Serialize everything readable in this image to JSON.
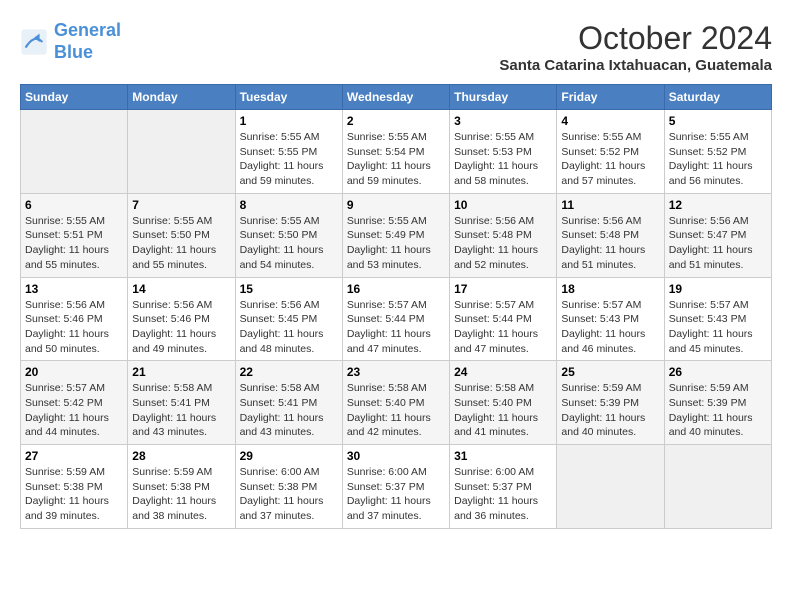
{
  "header": {
    "logo_line1": "General",
    "logo_line2": "Blue",
    "month": "October 2024",
    "location": "Santa Catarina Ixtahuacan, Guatemala"
  },
  "days_of_week": [
    "Sunday",
    "Monday",
    "Tuesday",
    "Wednesday",
    "Thursday",
    "Friday",
    "Saturday"
  ],
  "weeks": [
    [
      {
        "day": "",
        "sunrise": "",
        "sunset": "",
        "daylight": ""
      },
      {
        "day": "",
        "sunrise": "",
        "sunset": "",
        "daylight": ""
      },
      {
        "day": "1",
        "sunrise": "Sunrise: 5:55 AM",
        "sunset": "Sunset: 5:55 PM",
        "daylight": "Daylight: 11 hours and 59 minutes."
      },
      {
        "day": "2",
        "sunrise": "Sunrise: 5:55 AM",
        "sunset": "Sunset: 5:54 PM",
        "daylight": "Daylight: 11 hours and 59 minutes."
      },
      {
        "day": "3",
        "sunrise": "Sunrise: 5:55 AM",
        "sunset": "Sunset: 5:53 PM",
        "daylight": "Daylight: 11 hours and 58 minutes."
      },
      {
        "day": "4",
        "sunrise": "Sunrise: 5:55 AM",
        "sunset": "Sunset: 5:52 PM",
        "daylight": "Daylight: 11 hours and 57 minutes."
      },
      {
        "day": "5",
        "sunrise": "Sunrise: 5:55 AM",
        "sunset": "Sunset: 5:52 PM",
        "daylight": "Daylight: 11 hours and 56 minutes."
      }
    ],
    [
      {
        "day": "6",
        "sunrise": "Sunrise: 5:55 AM",
        "sunset": "Sunset: 5:51 PM",
        "daylight": "Daylight: 11 hours and 55 minutes."
      },
      {
        "day": "7",
        "sunrise": "Sunrise: 5:55 AM",
        "sunset": "Sunset: 5:50 PM",
        "daylight": "Daylight: 11 hours and 55 minutes."
      },
      {
        "day": "8",
        "sunrise": "Sunrise: 5:55 AM",
        "sunset": "Sunset: 5:50 PM",
        "daylight": "Daylight: 11 hours and 54 minutes."
      },
      {
        "day": "9",
        "sunrise": "Sunrise: 5:55 AM",
        "sunset": "Sunset: 5:49 PM",
        "daylight": "Daylight: 11 hours and 53 minutes."
      },
      {
        "day": "10",
        "sunrise": "Sunrise: 5:56 AM",
        "sunset": "Sunset: 5:48 PM",
        "daylight": "Daylight: 11 hours and 52 minutes."
      },
      {
        "day": "11",
        "sunrise": "Sunrise: 5:56 AM",
        "sunset": "Sunset: 5:48 PM",
        "daylight": "Daylight: 11 hours and 51 minutes."
      },
      {
        "day": "12",
        "sunrise": "Sunrise: 5:56 AM",
        "sunset": "Sunset: 5:47 PM",
        "daylight": "Daylight: 11 hours and 51 minutes."
      }
    ],
    [
      {
        "day": "13",
        "sunrise": "Sunrise: 5:56 AM",
        "sunset": "Sunset: 5:46 PM",
        "daylight": "Daylight: 11 hours and 50 minutes."
      },
      {
        "day": "14",
        "sunrise": "Sunrise: 5:56 AM",
        "sunset": "Sunset: 5:46 PM",
        "daylight": "Daylight: 11 hours and 49 minutes."
      },
      {
        "day": "15",
        "sunrise": "Sunrise: 5:56 AM",
        "sunset": "Sunset: 5:45 PM",
        "daylight": "Daylight: 11 hours and 48 minutes."
      },
      {
        "day": "16",
        "sunrise": "Sunrise: 5:57 AM",
        "sunset": "Sunset: 5:44 PM",
        "daylight": "Daylight: 11 hours and 47 minutes."
      },
      {
        "day": "17",
        "sunrise": "Sunrise: 5:57 AM",
        "sunset": "Sunset: 5:44 PM",
        "daylight": "Daylight: 11 hours and 47 minutes."
      },
      {
        "day": "18",
        "sunrise": "Sunrise: 5:57 AM",
        "sunset": "Sunset: 5:43 PM",
        "daylight": "Daylight: 11 hours and 46 minutes."
      },
      {
        "day": "19",
        "sunrise": "Sunrise: 5:57 AM",
        "sunset": "Sunset: 5:43 PM",
        "daylight": "Daylight: 11 hours and 45 minutes."
      }
    ],
    [
      {
        "day": "20",
        "sunrise": "Sunrise: 5:57 AM",
        "sunset": "Sunset: 5:42 PM",
        "daylight": "Daylight: 11 hours and 44 minutes."
      },
      {
        "day": "21",
        "sunrise": "Sunrise: 5:58 AM",
        "sunset": "Sunset: 5:41 PM",
        "daylight": "Daylight: 11 hours and 43 minutes."
      },
      {
        "day": "22",
        "sunrise": "Sunrise: 5:58 AM",
        "sunset": "Sunset: 5:41 PM",
        "daylight": "Daylight: 11 hours and 43 minutes."
      },
      {
        "day": "23",
        "sunrise": "Sunrise: 5:58 AM",
        "sunset": "Sunset: 5:40 PM",
        "daylight": "Daylight: 11 hours and 42 minutes."
      },
      {
        "day": "24",
        "sunrise": "Sunrise: 5:58 AM",
        "sunset": "Sunset: 5:40 PM",
        "daylight": "Daylight: 11 hours and 41 minutes."
      },
      {
        "day": "25",
        "sunrise": "Sunrise: 5:59 AM",
        "sunset": "Sunset: 5:39 PM",
        "daylight": "Daylight: 11 hours and 40 minutes."
      },
      {
        "day": "26",
        "sunrise": "Sunrise: 5:59 AM",
        "sunset": "Sunset: 5:39 PM",
        "daylight": "Daylight: 11 hours and 40 minutes."
      }
    ],
    [
      {
        "day": "27",
        "sunrise": "Sunrise: 5:59 AM",
        "sunset": "Sunset: 5:38 PM",
        "daylight": "Daylight: 11 hours and 39 minutes."
      },
      {
        "day": "28",
        "sunrise": "Sunrise: 5:59 AM",
        "sunset": "Sunset: 5:38 PM",
        "daylight": "Daylight: 11 hours and 38 minutes."
      },
      {
        "day": "29",
        "sunrise": "Sunrise: 6:00 AM",
        "sunset": "Sunset: 5:38 PM",
        "daylight": "Daylight: 11 hours and 37 minutes."
      },
      {
        "day": "30",
        "sunrise": "Sunrise: 6:00 AM",
        "sunset": "Sunset: 5:37 PM",
        "daylight": "Daylight: 11 hours and 37 minutes."
      },
      {
        "day": "31",
        "sunrise": "Sunrise: 6:00 AM",
        "sunset": "Sunset: 5:37 PM",
        "daylight": "Daylight: 11 hours and 36 minutes."
      },
      {
        "day": "",
        "sunrise": "",
        "sunset": "",
        "daylight": ""
      },
      {
        "day": "",
        "sunrise": "",
        "sunset": "",
        "daylight": ""
      }
    ]
  ]
}
